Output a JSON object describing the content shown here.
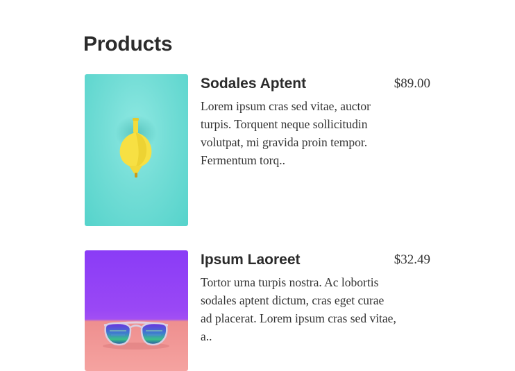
{
  "page": {
    "title": "Products"
  },
  "products": [
    {
      "name": "Sodales Aptent",
      "price": "$89.00",
      "description": "Lorem ipsum cras sed vitae, auctor turpis. Torquent neque sollicitudin volutpat, mi gravida proin tempor. Fermentum torq..",
      "image": {
        "subject": "yellow-funnel-on-teal",
        "background_color": "#6fdcd5"
      }
    },
    {
      "name": "Ipsum Laoreet",
      "price": "$32.49",
      "description": "Tortor urna turpis nostra. Ac lobortis sodales aptent dictum, cras eget curae ad placerat. Lorem ipsum cras sed vitae, a..",
      "image": {
        "subject": "sunglasses-on-pink-and-purple",
        "background_color": "#9546f5"
      }
    }
  ]
}
